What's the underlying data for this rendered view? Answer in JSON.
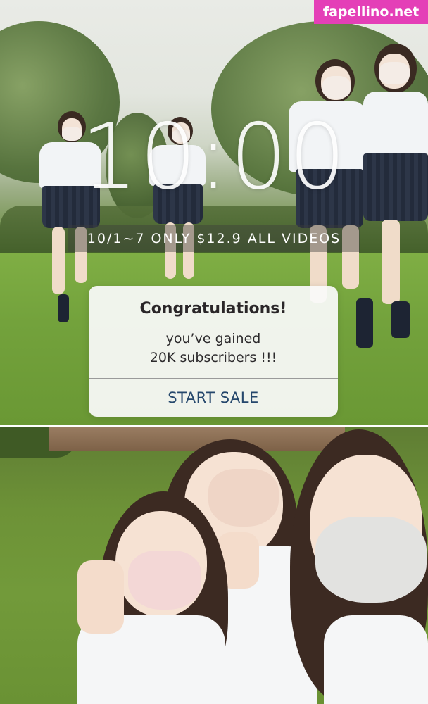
{
  "watermark": {
    "text": "fapellino.net"
  },
  "timer": {
    "text": "10:00"
  },
  "promo": {
    "text": "10/1~7 ONLY $12.9  ALL VIDEOS"
  },
  "dialog": {
    "title": "Congratulations!",
    "message_line1": "you’ve gained",
    "message_line2": "20K subscribers !!!",
    "button_label": "START SALE"
  },
  "colors": {
    "watermark_bg": "#e43fb7",
    "button_text": "#25476c",
    "dialog_bg": "#fafafa"
  }
}
